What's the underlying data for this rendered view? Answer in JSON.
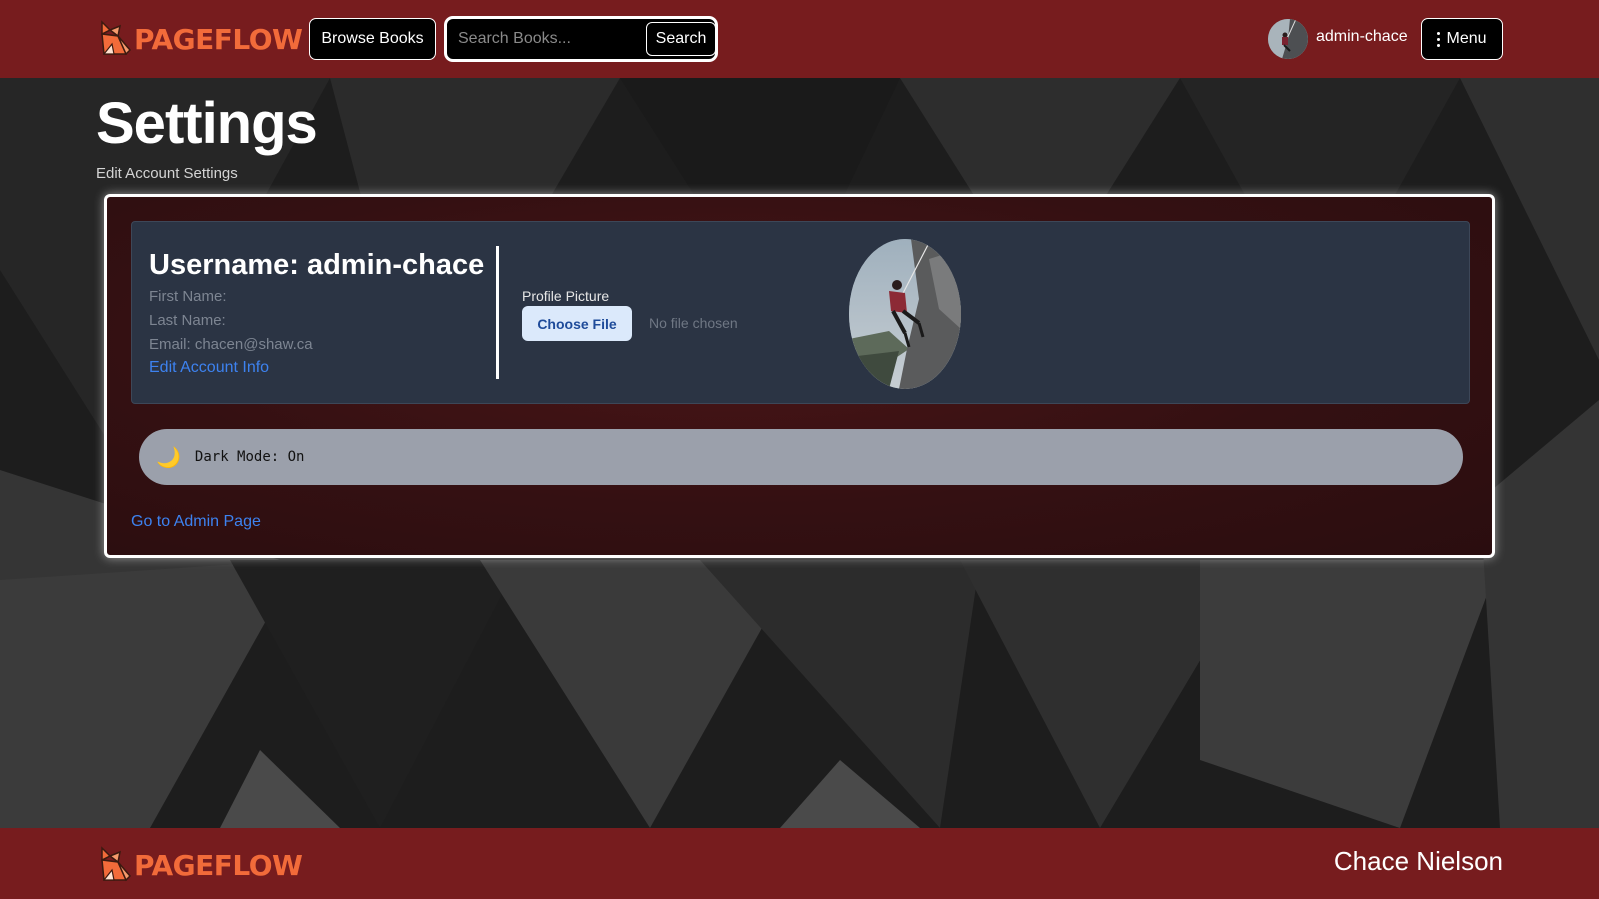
{
  "brand": {
    "name": "PAGEFLOW",
    "accent": "#f26b3a",
    "header_color": "#771c1e"
  },
  "header": {
    "browse_label": "Browse Books",
    "search_placeholder": "Search Books...",
    "search_value": "",
    "search_button": "Search",
    "username": "admin-chace",
    "menu_label": "Menu"
  },
  "page": {
    "title": "Settings",
    "subtitle": "Edit Account Settings"
  },
  "account": {
    "username_heading": "Username: admin-chace",
    "first_name": "First Name:",
    "last_name": "Last Name:",
    "email": "Email: chacen@shaw.ca",
    "edit_link": "Edit Account Info",
    "profile_picture_label": "Profile Picture",
    "choose_file_label": "Choose File",
    "no_file_text": "No file chosen"
  },
  "dark_mode": {
    "icon": "moon-icon",
    "glyph": "🌙",
    "label": "Dark Mode: On"
  },
  "admin_link": "Go to Admin Page",
  "footer": {
    "author": "Chace Nielson"
  }
}
